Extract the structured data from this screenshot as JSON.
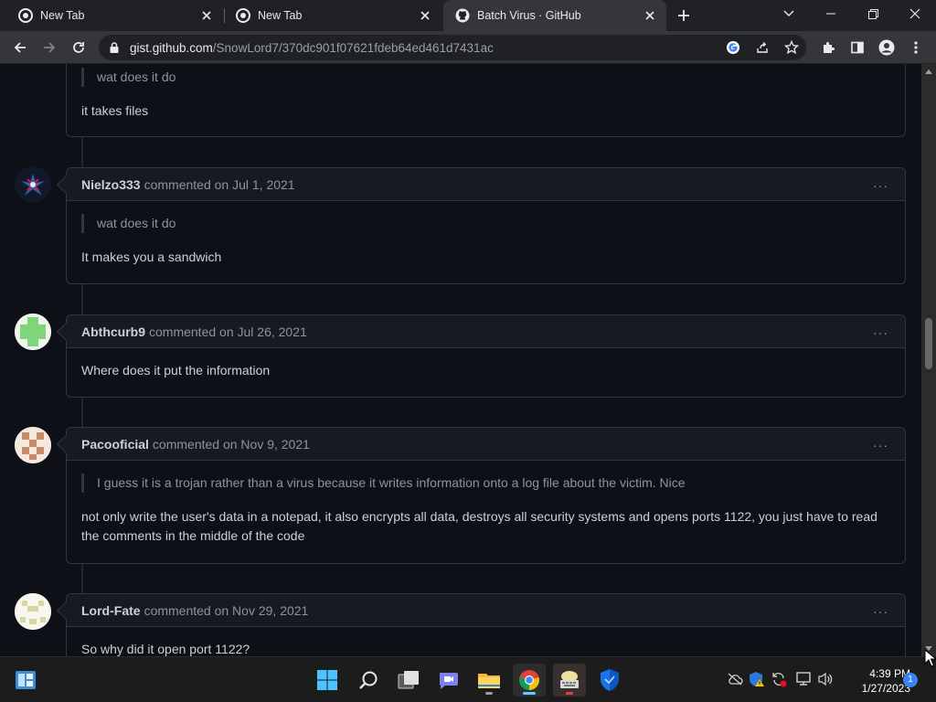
{
  "browser": {
    "tabs": [
      {
        "title": "New Tab",
        "active": false
      },
      {
        "title": "New Tab",
        "active": false
      },
      {
        "title": "Batch Virus · GitHub",
        "active": true
      }
    ],
    "url_host": "gist.github.com",
    "url_path": "/SnowLord7/370dc901f07621fdeb64ed461d7431ac"
  },
  "comments": [
    {
      "author": "",
      "meta": "",
      "quote": "wat does it do",
      "text": "it takes files"
    },
    {
      "author": "Nielzo333",
      "meta": "commented on Jul 1, 2021",
      "quote": "wat does it do",
      "text": "It makes you a sandwich",
      "menu": "···"
    },
    {
      "author": "Abthcurb9",
      "meta": "commented on Jul 26, 2021",
      "quote": "",
      "text": "Where does it put the information",
      "menu": "···"
    },
    {
      "author": "Pacooficial",
      "meta": "commented on Nov 9, 2021",
      "quote": "I guess it is a trojan rather than a virus because it writes information onto a log file about the victim. Nice",
      "text": "not only write the user's data in a notepad, it also encrypts all data, destroys all security systems and opens ports 1122, you just have to read the comments in the middle of the code",
      "menu": "···"
    },
    {
      "author": "Lord-Fate",
      "meta": "commented on Nov 29, 2021",
      "quote": "",
      "text": "So why did it open port 1122?",
      "menu": "···"
    }
  ],
  "taskbar": {
    "time": "4:39 PM",
    "date": "1/27/2023",
    "notification_count": "1"
  },
  "colors": {
    "page_bg": "#0d1117",
    "comment_header_bg": "#161b22",
    "border": "#30363d",
    "text": "#c9d1d9",
    "muted": "#8b949e",
    "accent": "#60cdff"
  }
}
